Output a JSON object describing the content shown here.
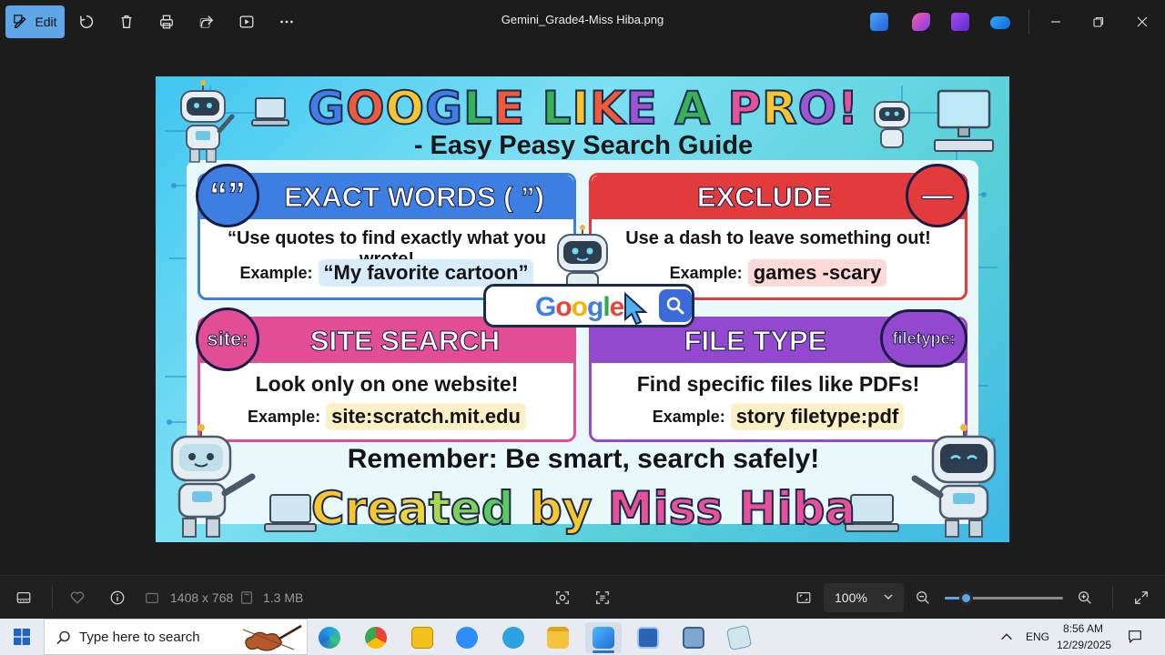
{
  "window": {
    "file_title": "Gemini_Grade4-Miss Hiba.png",
    "edit_label": "Edit"
  },
  "toolbar_icons": [
    "rotate-icon",
    "delete-icon",
    "print-icon",
    "share-icon",
    "slideshow-icon",
    "more-icon"
  ],
  "app_icons": [
    "designer-icon",
    "clipchamp-icon",
    "editor-icon",
    "onedrive-icon"
  ],
  "poster": {
    "headline_letters": [
      {
        "ch": "G",
        "color": "#3f7ee8"
      },
      {
        "ch": "O",
        "color": "#f05a3a"
      },
      {
        "ch": "O",
        "color": "#f7c531"
      },
      {
        "ch": "G",
        "color": "#3f7ee8"
      },
      {
        "ch": "L",
        "color": "#36b357"
      },
      {
        "ch": "E",
        "color": "#f05a3a"
      },
      {
        "ch": " ",
        "color": "#000000"
      },
      {
        "ch": "L",
        "color": "#36b357"
      },
      {
        "ch": "I",
        "color": "#f7c531"
      },
      {
        "ch": "K",
        "color": "#f05a3a"
      },
      {
        "ch": "E",
        "color": "#9b55d6"
      },
      {
        "ch": " ",
        "color": "#000000"
      },
      {
        "ch": "A",
        "color": "#36b357"
      },
      {
        "ch": " ",
        "color": "#000000"
      },
      {
        "ch": "P",
        "color": "#e6519a"
      },
      {
        "ch": "R",
        "color": "#f7c531"
      },
      {
        "ch": "O",
        "color": "#9b55d6"
      },
      {
        "ch": "!",
        "color": "#e6519a"
      }
    ],
    "subhead": "- Easy Peasy Search Guide",
    "cards": {
      "exact": {
        "badge": "“”",
        "title": "EXACT WORDS ( ”)",
        "desc": "“Use quotes to find exactly what you wrote!",
        "ex_label": "Example:",
        "ex_value": "“My favorite cartoon”",
        "color": "#3d7fe0"
      },
      "exclude": {
        "badge": "—",
        "title": "EXCLUDE",
        "desc": "Use a dash to leave something out!",
        "ex_label": "Example:",
        "ex_value": "games -scary",
        "color": "#e33b3b"
      },
      "site": {
        "badge": "site:",
        "title": "SITE SEARCH",
        "desc": "Look only on one website!",
        "ex_label": "Example:",
        "ex_value": "site:scratch.mit.edu",
        "color": "#e24d95"
      },
      "filetype": {
        "badge": "filetype:",
        "title": "FILE TYPE",
        "desc": "Find specific files like PDFs!",
        "ex_label": "Example:",
        "ex_value": "story filetype:pdf",
        "color": "#9248cf"
      }
    },
    "google_word": [
      {
        "ch": "G",
        "color": "#3f7ee8"
      },
      {
        "ch": "o",
        "color": "#e8453c"
      },
      {
        "ch": "o",
        "color": "#f5b400"
      },
      {
        "ch": "g",
        "color": "#3f7ee8"
      },
      {
        "ch": "l",
        "color": "#34a853"
      },
      {
        "ch": "e",
        "color": "#e8453c"
      }
    ],
    "remember": "Remember: Be smart, search safely!",
    "creator_letters": [
      {
        "ch": "C",
        "color": "#f7c531"
      },
      {
        "ch": "r",
        "color": "#f7c531"
      },
      {
        "ch": "e",
        "color": "#f7c531"
      },
      {
        "ch": "a",
        "color": "#f0d23a"
      },
      {
        "ch": "t",
        "color": "#a8d84b"
      },
      {
        "ch": "e",
        "color": "#7fd05a"
      },
      {
        "ch": "d",
        "color": "#5cc85e"
      },
      {
        "ch": " ",
        "color": "#000000"
      },
      {
        "ch": "b",
        "color": "#f7c531"
      },
      {
        "ch": "y",
        "color": "#f7c531"
      },
      {
        "ch": " ",
        "color": "#000000"
      },
      {
        "ch": "M",
        "color": "#e6519a"
      },
      {
        "ch": "i",
        "color": "#e6519a"
      },
      {
        "ch": "s",
        "color": "#e6519a"
      },
      {
        "ch": "s",
        "color": "#e6519a"
      },
      {
        "ch": " ",
        "color": "#000000"
      },
      {
        "ch": "H",
        "color": "#e6519a"
      },
      {
        "ch": "i",
        "color": "#e6519a"
      },
      {
        "ch": "b",
        "color": "#e6519a"
      },
      {
        "ch": "a",
        "color": "#e6519a"
      }
    ]
  },
  "statusbar": {
    "dimensions": "1408 x 768",
    "file_size": "1.3 MB",
    "zoom_value": "100%",
    "zoom_level": 0.18
  },
  "taskbar": {
    "search_placeholder": "Type here to search",
    "apps": [
      "edge-icon",
      "chrome-icon",
      "pdf-icon",
      "zoom-icon",
      "telegram-icon",
      "file-explorer-icon",
      "photos-icon",
      "app-icon",
      "app-icon",
      "notepad-icon"
    ],
    "language": "ENG",
    "time": "8:56 AM",
    "date": "12/29/2025"
  }
}
